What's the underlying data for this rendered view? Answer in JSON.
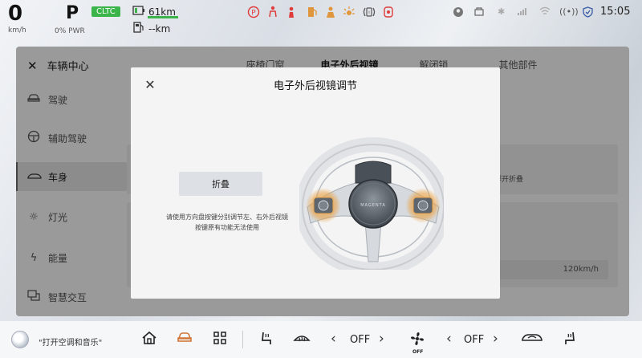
{
  "status": {
    "speed": "0",
    "speed_unit": "km/h",
    "gear": "P",
    "power": "0% PWR",
    "cltc": "CLTC",
    "range_ev": "61km",
    "range_fuel": "--km",
    "time": "15:05"
  },
  "sidebar": {
    "title": "车辆中心",
    "items": [
      {
        "label": "驾驶",
        "icon": "car-icon"
      },
      {
        "label": "辅助驾驶",
        "icon": "steering-wheel-icon"
      },
      {
        "label": "车身",
        "icon": "car-body-icon"
      },
      {
        "label": "灯光",
        "icon": "sun-icon"
      },
      {
        "label": "能量",
        "icon": "lightning-icon"
      },
      {
        "label": "智慧交互",
        "icon": "interaction-icon"
      }
    ],
    "active_index": 2
  },
  "tabs": [
    "座椅门窗",
    "电子外后视镜",
    "解闭锁",
    "其他部件"
  ],
  "background_texts": {
    "fold_hint": "解开折叠",
    "speed_value": "120km/h"
  },
  "modal": {
    "title": "电子外后视镜调节",
    "fold_button": "折叠",
    "hint_line1": "请使用方向盘按键分别调节左、右外后视镜",
    "hint_line2": "按键原有功能无法使用",
    "wheel_badge": "MAGENTA"
  },
  "bottom": {
    "voice_prompt": "\"打开空调和音乐\"",
    "left_temp": "OFF",
    "right_temp": "OFF",
    "fan_off": "OFF"
  },
  "colors": {
    "accent": "#d2783c",
    "cltc_green": "#3bb54a",
    "highlight_orange": "#e0963c"
  }
}
